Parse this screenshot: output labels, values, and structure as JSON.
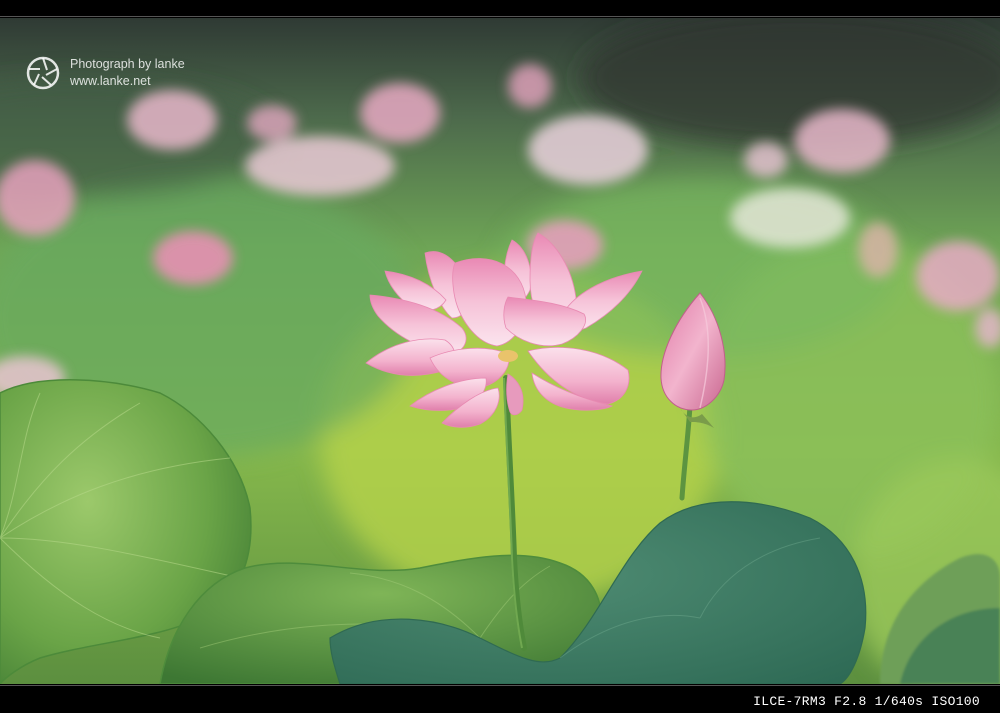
{
  "watermark": {
    "line1": "Photograph by lanke",
    "line2": "www.lanke.net"
  },
  "exif": "ILCE-7RM3 F2.8 1/640s ISO100",
  "colors": {
    "frame": "#000000",
    "petal": "#f3b8cf",
    "leaf": "#5d9a4a",
    "background_green": "#7dbb5a"
  }
}
